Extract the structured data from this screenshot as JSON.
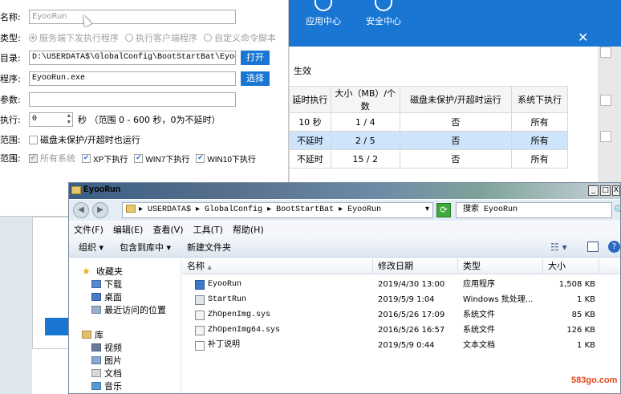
{
  "background_app": {
    "nav": [
      {
        "label": "应用中心",
        "icon": "app-center-icon"
      },
      {
        "label": "安全中心",
        "icon": "shield-icon"
      }
    ],
    "close_glyph": "✕",
    "effect_label": "生效",
    "table": {
      "headers": [
        "延时执行",
        "大小（MB）/个数",
        "磁盘未保护/开超时运行",
        "系统下执行"
      ],
      "rows": [
        [
          "10 秒",
          "1 / 4",
          "否",
          "所有"
        ],
        [
          "不延时",
          "2 / 5",
          "否",
          "所有"
        ],
        [
          "不延时",
          "15 / 2",
          "否",
          "所有"
        ]
      ],
      "selected_row": 1
    }
  },
  "settings": {
    "name_label": "名称:",
    "name_value": "EyooRun",
    "type_label": "类型:",
    "type_options": [
      {
        "label": "服务端下发执行程序",
        "selected": true
      },
      {
        "label": "执行客户端程序",
        "selected": false
      },
      {
        "label": "自定义命令脚本",
        "selected": false
      }
    ],
    "dir_label": "目录:",
    "dir_value": "D:\\USERDATA$\\GlobalConfig\\BootStartBat\\EyooRun\\",
    "open_button": "打开",
    "program_label": "程序:",
    "program_value": "EyooRun.exe",
    "select_button": "选择",
    "params_label": "参数:",
    "params_value": "",
    "delay_label": "执行:",
    "delay_value": "0",
    "delay_hint": "秒 （范围 0 - 600 秒，0为不延时）",
    "scope1_label": "范围:",
    "scope1_option": "磁盘未保护/开超时也运行",
    "scope2_label": "范围:",
    "systems": [
      {
        "label": "所有系统",
        "checked": true,
        "disabled": true
      },
      {
        "label": "XP下执行",
        "checked": true,
        "disabled": false
      },
      {
        "label": "WIN7下执行",
        "checked": true,
        "disabled": false
      },
      {
        "label": "WIN10下执行",
        "checked": true,
        "disabled": false
      }
    ]
  },
  "explorer": {
    "title": "EyooRun",
    "window_buttons": [
      "_",
      "□",
      "X"
    ],
    "back_glyph": "◀",
    "forward_glyph": "▶",
    "address": "▸ USERDATA$ ▸ GlobalConfig ▸ BootStartBat ▸ EyooRun",
    "address_dropdown": "▾",
    "refresh_glyph": "⟳",
    "search_placeholder": "搜索 EyooRun",
    "search_glyph": "🔍",
    "menu": [
      "文件(F)",
      "编辑(E)",
      "查看(V)",
      "工具(T)",
      "帮助(H)"
    ],
    "toolbar": [
      "组织 ▾",
      "包含到库中 ▾",
      "新建文件夹"
    ],
    "view_glyph": "☷ ▾",
    "help_glyph": "?",
    "nav": [
      {
        "label": "收藏夹",
        "icon": "star-icon",
        "indent": 0
      },
      {
        "label": "下载",
        "icon": "download-folder-icon",
        "indent": 1
      },
      {
        "label": "桌面",
        "icon": "desktop-icon",
        "indent": 1
      },
      {
        "label": "最近访问的位置",
        "icon": "recent-places-icon",
        "indent": 1
      },
      {
        "label": "库",
        "icon": "library-icon",
        "indent": 0
      },
      {
        "label": "视频",
        "icon": "videos-icon",
        "indent": 1
      },
      {
        "label": "图片",
        "icon": "pictures-icon",
        "indent": 1
      },
      {
        "label": "文档",
        "icon": "documents-icon",
        "indent": 1
      },
      {
        "label": "音乐",
        "icon": "music-icon",
        "indent": 1
      }
    ],
    "columns": [
      "名称",
      "修改日期",
      "类型",
      "大小"
    ],
    "sort_glyph": "▲",
    "files": [
      {
        "name": "EyooRun",
        "date": "2019/4/30 13:00",
        "type": "应用程序",
        "size": "1,508 KB",
        "kind": "exe"
      },
      {
        "name": "StartRun",
        "date": "2019/5/9 1:04",
        "type": "Windows 批处理...",
        "size": "1 KB",
        "kind": "bat"
      },
      {
        "name": "ZhOpenImg.sys",
        "date": "2016/5/26 17:09",
        "type": "系统文件",
        "size": "85 KB",
        "kind": "sys"
      },
      {
        "name": "ZhOpenImg64.sys",
        "date": "2016/5/26 16:57",
        "type": "系统文件",
        "size": "126 KB",
        "kind": "sys"
      },
      {
        "name": "补丁说明",
        "date": "2019/5/9 0:44",
        "type": "文本文档",
        "size": "1 KB",
        "kind": "txt"
      }
    ]
  },
  "watermark": "583go.com"
}
